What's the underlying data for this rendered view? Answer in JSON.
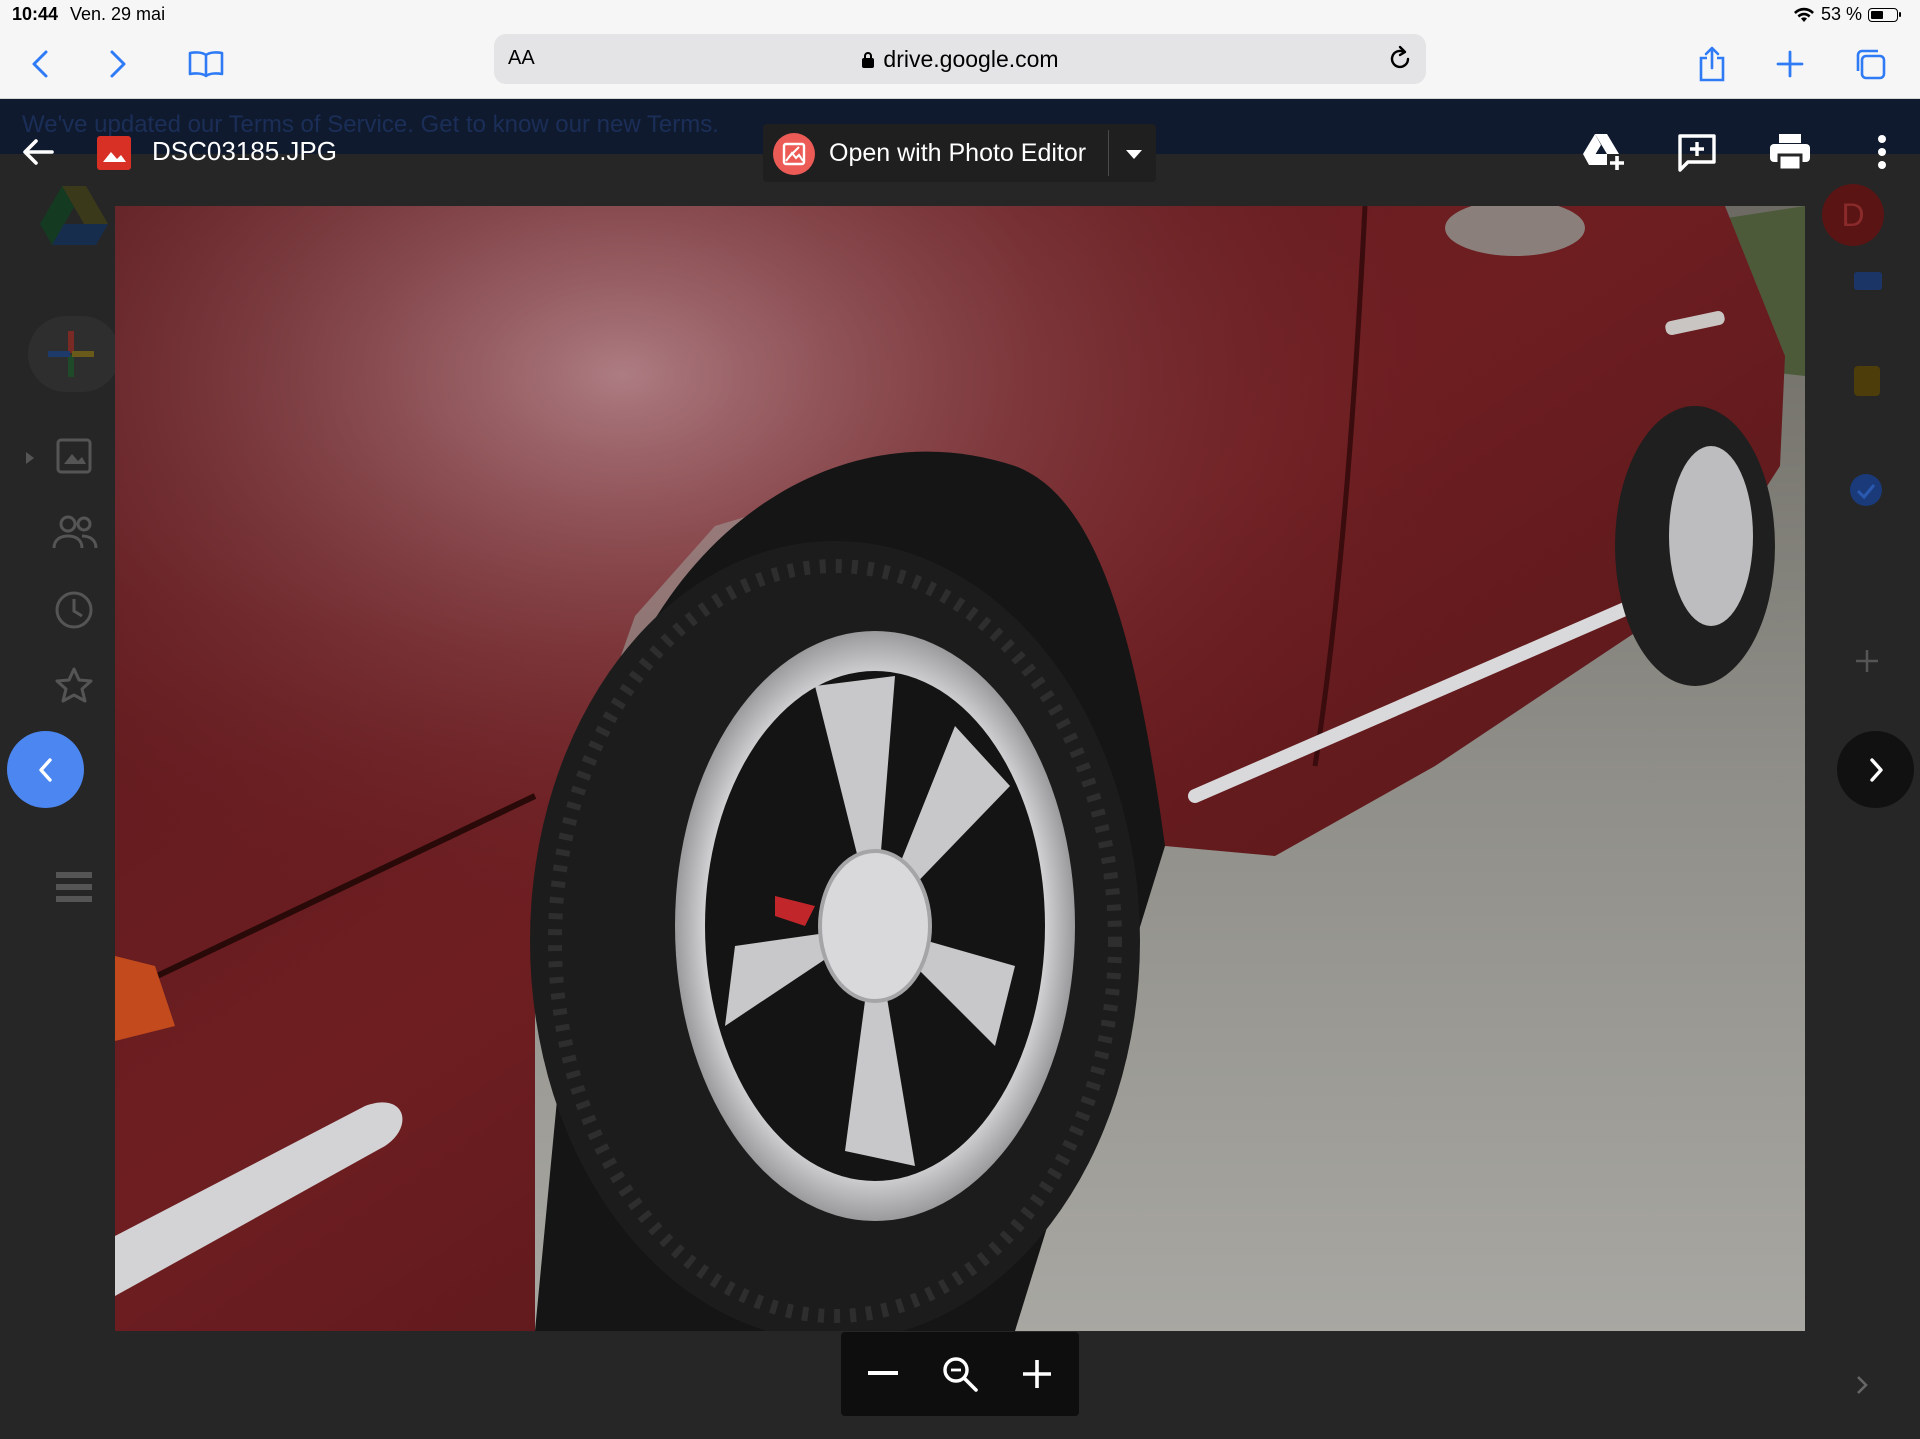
{
  "status_bar": {
    "time": "10:44",
    "date": "Ven. 29 mai",
    "battery": "53 %",
    "battery_level": 0.53
  },
  "safari": {
    "reader_label": "AA",
    "url": "drive.google.com"
  },
  "background_page": {
    "banner_text": "We've updated our Terms of Service. Get to know our new Terms.",
    "avatar_initial": "D"
  },
  "viewer": {
    "file_name": "DSC03185.JPG",
    "open_with_label": "Open with Photo Editor",
    "icons": [
      "add-to-drive-icon",
      "add-comment-icon",
      "print-icon",
      "more-vert-icon"
    ]
  },
  "colors": {
    "prev_button": "#4c86f0",
    "file_icon": "#d93025",
    "photo_editor": "#ec5b55"
  }
}
